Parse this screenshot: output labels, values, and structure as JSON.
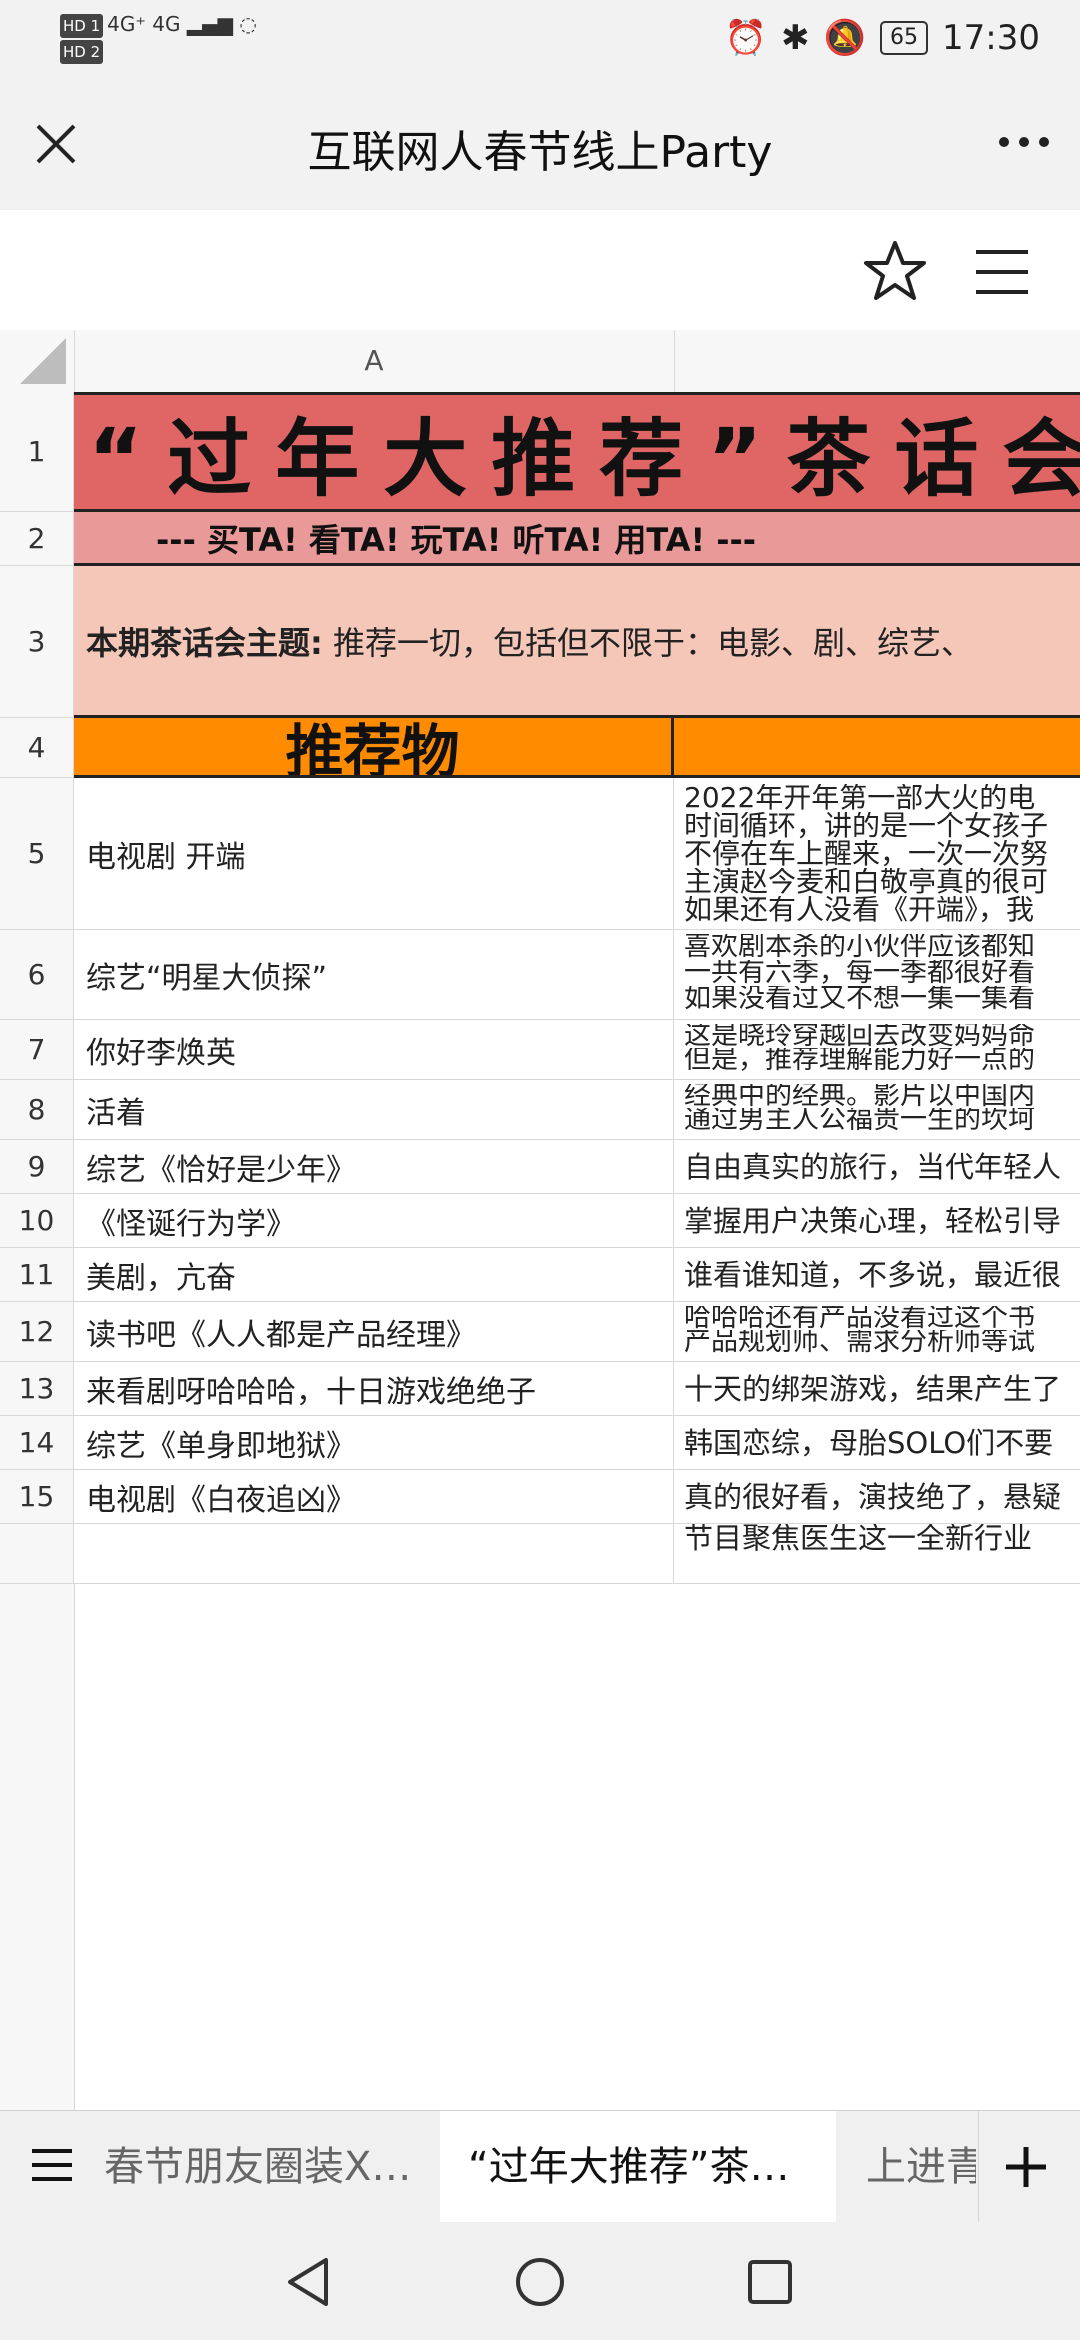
{
  "status_bar": {
    "hd1": "HD 1",
    "hd2": "HD 2",
    "network": "4G⁺ 4G",
    "battery": "65",
    "time": "17:30"
  },
  "nav": {
    "title": "互联网人春节线上Party"
  },
  "sheet": {
    "column_a": "A",
    "banner_title": "“过年大推荐”茶话会",
    "banner_subtitle": "--- 买TA!  看TA!  玩TA!  听TA!  用TA!  ---",
    "theme_label": "本期茶话会主题:",
    "theme_text": "推荐一切，包括但不限于：电影、剧、综艺、",
    "header_item": "推荐物",
    "rows": [
      {
        "num": "1"
      },
      {
        "num": "2"
      },
      {
        "num": "3"
      },
      {
        "num": "4"
      },
      {
        "num": "5",
        "item": "电视剧 开端",
        "desc": [
          "2022年开年第一部大火的电",
          "时间循环，讲的是一个女孩子",
          "不停在车上醒来，一次一次努",
          "主演赵今麦和白敬亭真的很可",
          "如果还有人没看《开端》，我"
        ]
      },
      {
        "num": "6",
        "item": "综艺“明星大侦探”",
        "desc": [
          "喜欢剧本杀的小伙伴应该都知",
          "一共有六季，每一季都很好看",
          "如果没看过又不想一集一集看"
        ]
      },
      {
        "num": "7",
        "item": "你好李焕英",
        "desc": [
          "这是晓玲穿越回去改变妈妈命",
          "但是，推荐理解能力好一点的"
        ]
      },
      {
        "num": "8",
        "item": "活着",
        "desc": [
          "经典中的经典。影片以中国内",
          "通过男主人公福贵一生的坎坷"
        ]
      },
      {
        "num": "9",
        "item": "综艺《恰好是少年》",
        "desc": [
          "自由真实的旅行，当代年轻人"
        ]
      },
      {
        "num": "10",
        "item": "《怪诞行为学》",
        "desc": [
          "掌握用户决策心理，轻松引导"
        ]
      },
      {
        "num": "11",
        "item": "美剧，亢奋",
        "desc": [
          "谁看谁知道，不多说，最近很"
        ]
      },
      {
        "num": "12",
        "item": "读书吧《人人都是产品经理》",
        "desc": [
          "哈哈哈还有产品没看过这个书",
          "产品规划师、需求分析师等试"
        ]
      },
      {
        "num": "13",
        "item": "来看剧呀哈哈哈，十日游戏绝绝子",
        "desc": [
          "十天的绑架游戏，结果产生了"
        ]
      },
      {
        "num": "14",
        "item": "综艺《单身即地狱》",
        "desc": [
          "韩国恋综，母胎SOLO们不要"
        ]
      },
      {
        "num": "15",
        "item": "电视剧《白夜追凶》",
        "desc": [
          "真的很好看，演技绝了，悬疑"
        ]
      },
      {
        "num": "",
        "item": "",
        "desc": [
          "节目聚焦医生这一全新行业"
        ]
      }
    ]
  },
  "tabs": {
    "tab1": "春节朋友圈装X…",
    "tab2": "“过年大推荐”茶…",
    "tab3": "上进青"
  }
}
